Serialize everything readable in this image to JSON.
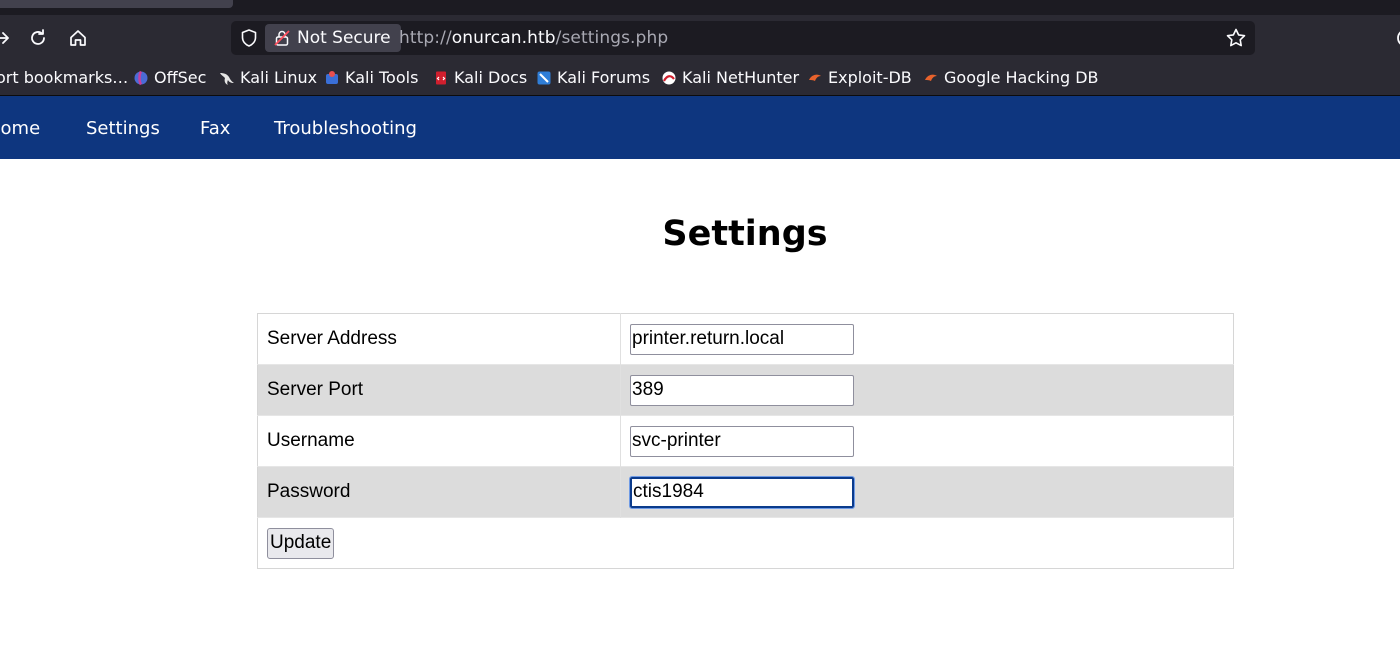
{
  "browser": {
    "security_label": "Not Secure",
    "url_scheme": "http://",
    "url_host": "onurcan.htb",
    "url_path": "/settings.php"
  },
  "bookmarks": [
    {
      "label": "ort bookmarks…"
    },
    {
      "label": "OffSec",
      "icon": "offsec-icon"
    },
    {
      "label": "Kali Linux",
      "icon": "kali-dragon-icon"
    },
    {
      "label": "Kali Tools",
      "icon": "kali-tools-icon"
    },
    {
      "label": "Kali Docs",
      "icon": "kali-docs-icon"
    },
    {
      "label": "Kali Forums",
      "icon": "kali-forums-icon"
    },
    {
      "label": "Kali NetHunter",
      "icon": "nethunter-icon"
    },
    {
      "label": "Exploit-DB",
      "icon": "exploit-db-icon"
    },
    {
      "label": "Google Hacking DB",
      "icon": "ghdb-icon"
    }
  ],
  "site_nav": [
    "Home",
    "Settings",
    "Fax",
    "Troubleshooting"
  ],
  "page": {
    "title": "Settings",
    "fields": [
      {
        "label": "Server Address",
        "value": "printer.return.local"
      },
      {
        "label": "Server Port",
        "value": "389"
      },
      {
        "label": "Username",
        "value": "svc-printer"
      },
      {
        "label": "Password",
        "value": "ctis1984"
      }
    ],
    "submit_label": "Update"
  },
  "colors": {
    "nav_bg": "#0e367f",
    "row_shade": "#dcdcdc",
    "browser_toolbar": "#2b2a33"
  }
}
